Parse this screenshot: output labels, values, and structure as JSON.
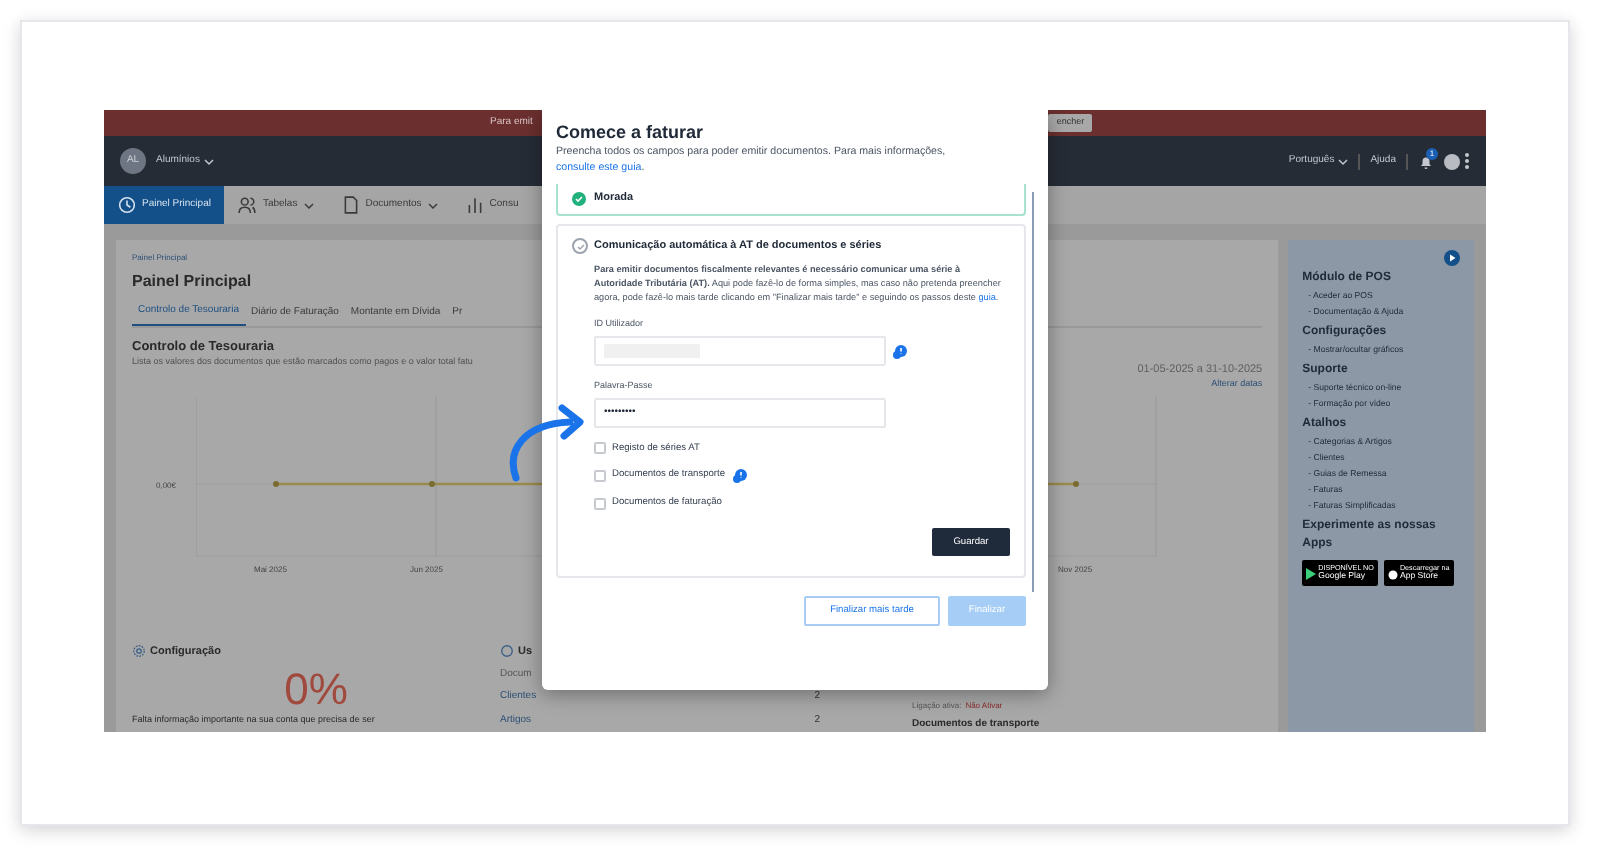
{
  "banner": {
    "text": "Para emit",
    "button": "encher"
  },
  "topbar": {
    "account_initials": "AL",
    "account": "Alumínios",
    "language": "Português",
    "help": "Ajuda",
    "notification_count": "1"
  },
  "menu": [
    {
      "label": "Painel Principal",
      "selected": true,
      "kind": "clock"
    },
    {
      "label": "Tabelas",
      "selected": false,
      "kind": "people"
    },
    {
      "label": "Documentos",
      "selected": false,
      "kind": "doc"
    },
    {
      "label": "Consu",
      "selected": false,
      "kind": "chart"
    }
  ],
  "breadcrumb": "Painel Principal",
  "page_title": "Painel Principal",
  "tabs": [
    {
      "label": "Controlo de Tesouraria",
      "selected": true
    },
    {
      "label": "Diário de Faturação",
      "selected": false
    },
    {
      "label": "Montante em Dívida",
      "selected": false
    },
    {
      "label": "Pr",
      "selected": false
    }
  ],
  "treasury": {
    "title": "Controlo de Tesouraria",
    "subtitle": "Lista os valores dos documentos que estão marcados como pagos e o valor total fatu",
    "date_range": "01-05-2025 a 31-10-2025",
    "change_dates": "Alterar datas",
    "y_label": "0,00€",
    "x_labels": [
      "Mai 2025",
      "Jun 2025",
      "Nov 2025"
    ]
  },
  "config": {
    "title": "Configuração",
    "percent": "0%",
    "text": "Falta informação importante na sua conta que precisa de ser"
  },
  "usage": {
    "title": "Us",
    "rows": [
      {
        "label": "Docum"
      },
      {
        "label": "Clientes",
        "count": "2"
      },
      {
        "label": "Artigos",
        "count": "2"
      }
    ]
  },
  "transport": {
    "status_label": "Ligação ativa:",
    "status_value": "Não Ativar",
    "title": "Documentos de transporte"
  },
  "sidebar": [
    {
      "title": "Módulo de POS",
      "items": [
        "- Aceder ao POS",
        "- Documentação & Ajuda"
      ]
    },
    {
      "title": "Configurações",
      "items": [
        "- Mostrar/ocultar gráficos"
      ]
    },
    {
      "title": "Suporte",
      "items": [
        "- Suporte técnico on-line",
        "- Formação por vídeo"
      ]
    },
    {
      "title": "Atalhos",
      "items": [
        "- Categorias & Artigos",
        "- Clientes",
        "- Guias de Remessa",
        "- Faturas",
        "- Faturas Simplificadas"
      ]
    },
    {
      "title": "Experimente as nossas Apps"
    }
  ],
  "stores": [
    {
      "small": "DISPONÍVEL NO",
      "name": "Google Play",
      "kind": "google"
    },
    {
      "small": "Descarregar na",
      "name": "App Store",
      "kind": "apple"
    }
  ],
  "modal": {
    "title": "Comece a faturar",
    "description": "Preencha todos os campos para poder emitir documentos. Para mais informações, ",
    "description_link": "consulte este guia",
    "description_end": ".",
    "steps": [
      {
        "title": "Morada",
        "done": true
      }
    ],
    "section": {
      "title": "Comunicação automática à AT de documentos e séries",
      "text": "**Para emitir documentos fiscalmente relevantes é necessário comunicar uma série à Autoridade Tributária (AT).** Aqui pode fazê-lo de forma simples, mas caso não pretenda preencher agora, pode fazê-lo mais tarde clicando em \"Finalizar mais tarde\" e seguindo os passos deste ",
      "link": "guia",
      "text_end": ".",
      "fields": [
        {
          "label": "ID Utilizador",
          "redacted": true,
          "info": true
        },
        {
          "label": "Palavra-Passe",
          "value": "•••••••••",
          "redacted": false,
          "info": false
        }
      ],
      "options": [
        {
          "label": "Registo de séries AT",
          "checked": false,
          "info": false
        },
        {
          "label": "Documentos de transporte",
          "checked": false,
          "info": true
        },
        {
          "label": "Documentos de faturação",
          "checked": false,
          "info": false
        }
      ],
      "save": "Guardar"
    },
    "later": "Finalizar mais tarde",
    "finish": "Finalizar",
    "finish_disabled": true
  }
}
